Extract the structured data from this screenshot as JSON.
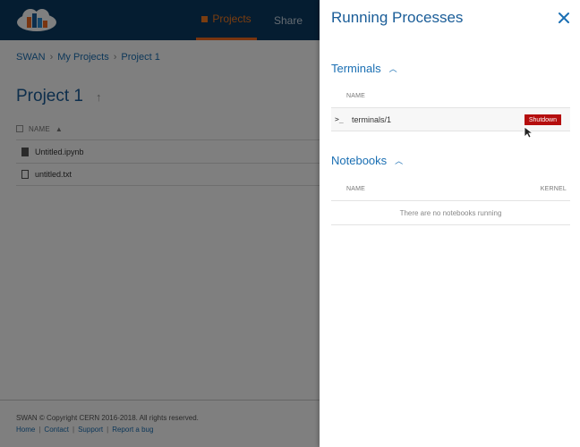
{
  "topbar": {
    "nav_projects": "Projects",
    "nav_share": "Share"
  },
  "breadcrumb": [
    "SWAN",
    "My Projects",
    "Project 1"
  ],
  "page_title": "Project 1",
  "file_list": {
    "name_header": "NAME",
    "files": [
      {
        "name": "Untitled.ipynb",
        "icon": "notebook-icon"
      },
      {
        "name": "untitled.txt",
        "icon": "file-icon"
      }
    ]
  },
  "footer": {
    "copyright": "SWAN © Copyright CERN 2016-2018. All rights reserved.",
    "links": [
      "Home",
      "Contact",
      "Support",
      "Report a bug"
    ]
  },
  "panel": {
    "title": "Running Processes",
    "terminals": {
      "title": "Terminals",
      "name_header": "NAME",
      "rows": [
        {
          "prompt": ">_",
          "name": "terminals/1",
          "action": "Shutdown"
        }
      ]
    },
    "notebooks": {
      "title": "Notebooks",
      "name_header": "NAME",
      "kernel_header": "KERNEL",
      "empty_message": "There are no notebooks running"
    }
  },
  "colors": {
    "topbar": "#0b3a63",
    "accent_orange": "#f47b20",
    "link_blue": "#1a6fb3",
    "shutdown_red": "#b50e0e"
  }
}
